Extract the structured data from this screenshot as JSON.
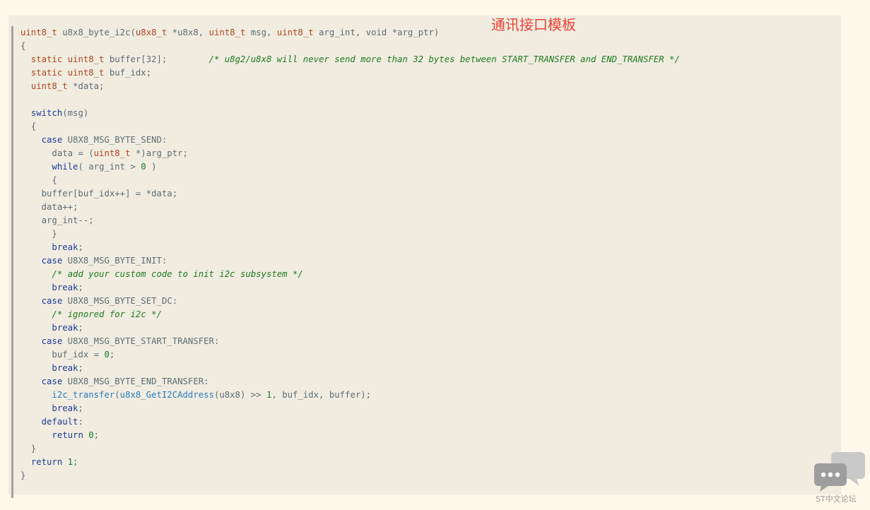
{
  "overlay_title": "通讯接口模板",
  "forum_widget": {
    "icon": "chat-bubbles-icon",
    "label": "ST中文论坛"
  },
  "code": {
    "language": "c",
    "lines": [
      [
        [
          "t",
          "uint8_t"
        ],
        [
          "p",
          " u8x8_byte_i2c("
        ],
        [
          "t",
          "u8x8_t"
        ],
        [
          "p",
          " *u8x8, "
        ],
        [
          "t",
          "uint8_t"
        ],
        [
          "p",
          " msg, "
        ],
        [
          "t",
          "uint8_t"
        ],
        [
          "p",
          " arg_int, void *arg_ptr)"
        ]
      ],
      [
        [
          "p",
          "{"
        ]
      ],
      [
        [
          "p",
          "  "
        ],
        [
          "t",
          "static uint8_t"
        ],
        [
          "p",
          " buffer[32];        "
        ],
        [
          "c",
          "/* u8g2/u8x8 will never send more than 32 bytes between START_TRANSFER and END_TRANSFER */"
        ]
      ],
      [
        [
          "p",
          "  "
        ],
        [
          "t",
          "static uint8_t"
        ],
        [
          "p",
          " buf_idx;"
        ]
      ],
      [
        [
          "p",
          "  "
        ],
        [
          "t",
          "uint8_t"
        ],
        [
          "p",
          " *data;"
        ]
      ],
      [
        [
          "p",
          ""
        ]
      ],
      [
        [
          "p",
          "  "
        ],
        [
          "k",
          "switch"
        ],
        [
          "p",
          "(msg)"
        ]
      ],
      [
        [
          "p",
          "  {"
        ]
      ],
      [
        [
          "p",
          "    "
        ],
        [
          "k",
          "case"
        ],
        [
          "p",
          " U8X8_MSG_BYTE_SEND:"
        ]
      ],
      [
        [
          "p",
          "      data = ("
        ],
        [
          "t",
          "uint8_t"
        ],
        [
          "p",
          " *)arg_ptr;"
        ]
      ],
      [
        [
          "p",
          "      "
        ],
        [
          "k",
          "while"
        ],
        [
          "p",
          "( arg_int > "
        ],
        [
          "n",
          "0"
        ],
        [
          "p",
          " )"
        ]
      ],
      [
        [
          "p",
          "      {"
        ]
      ],
      [
        [
          "p",
          "    buffer[buf_idx++] = *data;"
        ]
      ],
      [
        [
          "p",
          "    data++;"
        ]
      ],
      [
        [
          "p",
          "    arg_int--;"
        ]
      ],
      [
        [
          "p",
          "      }"
        ]
      ],
      [
        [
          "p",
          "      "
        ],
        [
          "k",
          "break"
        ],
        [
          "p",
          ";"
        ]
      ],
      [
        [
          "p",
          "    "
        ],
        [
          "k",
          "case"
        ],
        [
          "p",
          " U8X8_MSG_BYTE_INIT:"
        ]
      ],
      [
        [
          "p",
          "      "
        ],
        [
          "c",
          "/* add your custom code to init i2c subsystem */"
        ]
      ],
      [
        [
          "p",
          "      "
        ],
        [
          "k",
          "break"
        ],
        [
          "p",
          ";"
        ]
      ],
      [
        [
          "p",
          "    "
        ],
        [
          "k",
          "case"
        ],
        [
          "p",
          " U8X8_MSG_BYTE_SET_DC:"
        ]
      ],
      [
        [
          "p",
          "      "
        ],
        [
          "c",
          "/* ignored for i2c */"
        ]
      ],
      [
        [
          "p",
          "      "
        ],
        [
          "k",
          "break"
        ],
        [
          "p",
          ";"
        ]
      ],
      [
        [
          "p",
          "    "
        ],
        [
          "k",
          "case"
        ],
        [
          "p",
          " U8X8_MSG_BYTE_START_TRANSFER:"
        ]
      ],
      [
        [
          "p",
          "      buf_idx = "
        ],
        [
          "n",
          "0"
        ],
        [
          "p",
          ";"
        ]
      ],
      [
        [
          "p",
          "      "
        ],
        [
          "k",
          "break"
        ],
        [
          "p",
          ";"
        ]
      ],
      [
        [
          "p",
          "    "
        ],
        [
          "k",
          "case"
        ],
        [
          "p",
          " U8X8_MSG_BYTE_END_TRANSFER:"
        ]
      ],
      [
        [
          "p",
          "      "
        ],
        [
          "f",
          "i2c_transfer"
        ],
        [
          "p",
          "("
        ],
        [
          "f",
          "u8x8_GetI2CAddress"
        ],
        [
          "p",
          "(u8x8) >> "
        ],
        [
          "n",
          "1"
        ],
        [
          "p",
          ", buf_idx, buffer);"
        ]
      ],
      [
        [
          "p",
          "      "
        ],
        [
          "k",
          "break"
        ],
        [
          "p",
          ";"
        ]
      ],
      [
        [
          "p",
          "    "
        ],
        [
          "k",
          "default"
        ],
        [
          "p",
          ":"
        ]
      ],
      [
        [
          "p",
          "      "
        ],
        [
          "k",
          "return"
        ],
        [
          "p",
          " "
        ],
        [
          "n",
          "0"
        ],
        [
          "p",
          ";"
        ]
      ],
      [
        [
          "p",
          "  }"
        ]
      ],
      [
        [
          "p",
          "  "
        ],
        [
          "k",
          "return"
        ],
        [
          "p",
          " "
        ],
        [
          "n",
          "1"
        ],
        [
          "p",
          ";"
        ]
      ],
      [
        [
          "p",
          "}"
        ]
      ]
    ]
  }
}
